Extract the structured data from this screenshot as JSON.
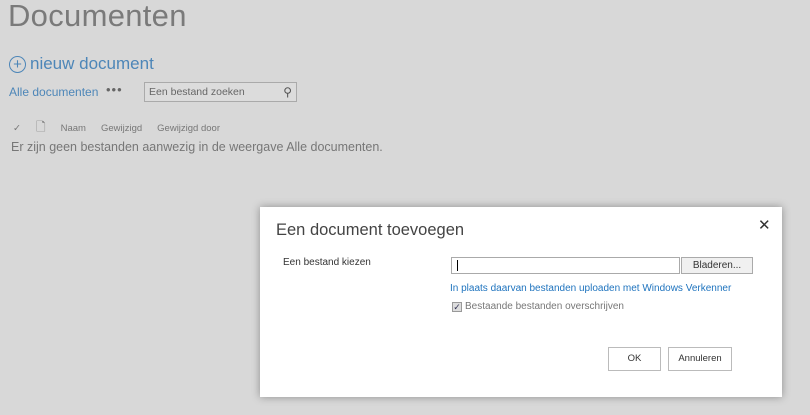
{
  "page": {
    "title": "Documenten",
    "new_document_label": "nieuw document",
    "view_label": "Alle documenten",
    "more_label": "•••",
    "search_placeholder": "Een bestand zoeken",
    "columns": [
      "Naam",
      "Gewijzigd",
      "Gewijzigd door"
    ],
    "empty_message": "Er zijn geen bestanden aanwezig in de weergave Alle documenten."
  },
  "dialog": {
    "title": "Een document toevoegen",
    "close_label": "✕",
    "file_label": "Een bestand kiezen",
    "file_value": "",
    "browse_label": "Bladeren...",
    "explorer_link": "In plaats daarvan bestanden uploaden met Windows Verkenner",
    "overwrite_label": "Bestaande bestanden overschrijven",
    "overwrite_checked": true,
    "ok_label": "OK",
    "cancel_label": "Annuleren"
  }
}
